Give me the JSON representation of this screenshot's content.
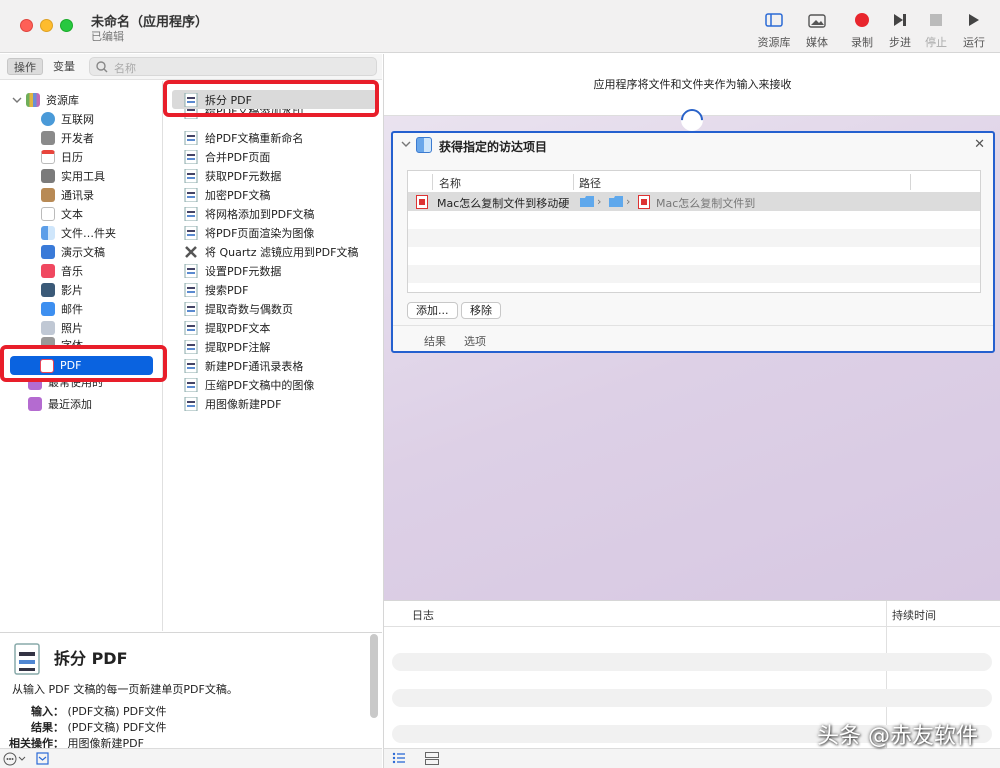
{
  "window": {
    "title": "未命名（应用程序）",
    "subtitle": "已编辑"
  },
  "toolbar": {
    "library": "资源库",
    "media": "媒体",
    "record": "录制",
    "step": "步进",
    "stop": "停止",
    "run": "运行"
  },
  "sidebar": {
    "tab_actions": "操作",
    "tab_variables": "变量",
    "search_placeholder": "名称",
    "library_root": "资源库",
    "library_items": [
      "互联网",
      "开发者",
      "日历",
      "实用工具",
      "通讯录",
      "文本",
      "文件…件夹",
      "演示文稿",
      "音乐",
      "影片",
      "邮件",
      "照片",
      "字体",
      "PDF",
      "最常使用的",
      "最近添加"
    ],
    "actions": [
      "拆分 PDF",
      "给PDF文稿添加水印",
      "给PDF文稿重新命名",
      "合并PDF页面",
      "获取PDF元数据",
      "加密PDF文稿",
      "将网格添加到PDF文稿",
      "将PDF页面渲染为图像",
      "将 Quartz 滤镜应用到PDF文稿",
      "设置PDF元数据",
      "搜索PDF",
      "提取奇数与偶数页",
      "提取PDF文本",
      "提取PDF注解",
      "新建PDF通讯录表格",
      "压缩PDF文稿中的图像",
      "用图像新建PDF"
    ]
  },
  "description": {
    "title": "拆分 PDF",
    "text": "从输入 PDF 文稿的每一页新建单页PDF文稿。",
    "input_label": "输入：",
    "input_value": "(PDF文稿) PDF文件",
    "result_label": "结果：",
    "result_value": "(PDF文稿) PDF文件",
    "related_label": "相关操作：",
    "related_value": "用图像新建PDF"
  },
  "workflow": {
    "header": "应用程序将文件和文件夹作为输入来接收",
    "action_title": "获得指定的访达项目",
    "col_name": "名称",
    "col_path": "路径",
    "row_name": "Mac怎么复制文件到移动硬",
    "row_path_tail": "Mac怎么复制文件到",
    "add_button": "添加...",
    "remove_button": "移除",
    "tab_results": "结果",
    "tab_options": "选项"
  },
  "log": {
    "col_log": "日志",
    "col_duration": "持续时间"
  },
  "watermark": "头条 @赤友软件",
  "colors": {
    "accent": "#0a63e0",
    "annotation": "#e81e2a",
    "action_border": "#2460cf"
  }
}
